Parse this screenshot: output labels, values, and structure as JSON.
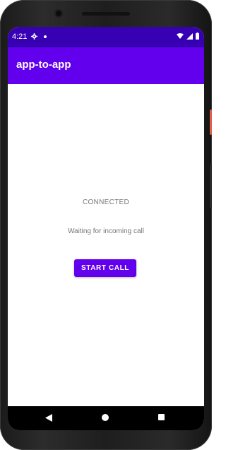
{
  "status_bar": {
    "time": "4:21",
    "icons": [
      "gear-icon",
      "notification-dot-icon",
      "wifi-icon",
      "signal-icon",
      "battery-icon"
    ]
  },
  "app_bar": {
    "title": "app-to-app"
  },
  "main": {
    "state_text": "CONNECTED",
    "waiting_text": "Waiting for incoming call",
    "start_call_label": "START CALL"
  },
  "nav_bar": {
    "icons": [
      "back-icon",
      "home-icon",
      "recents-icon"
    ]
  },
  "colors": {
    "status_bar": "#3700b3",
    "app_bar": "#6200ee",
    "button": "#6200ee",
    "text_secondary": "#757575"
  }
}
